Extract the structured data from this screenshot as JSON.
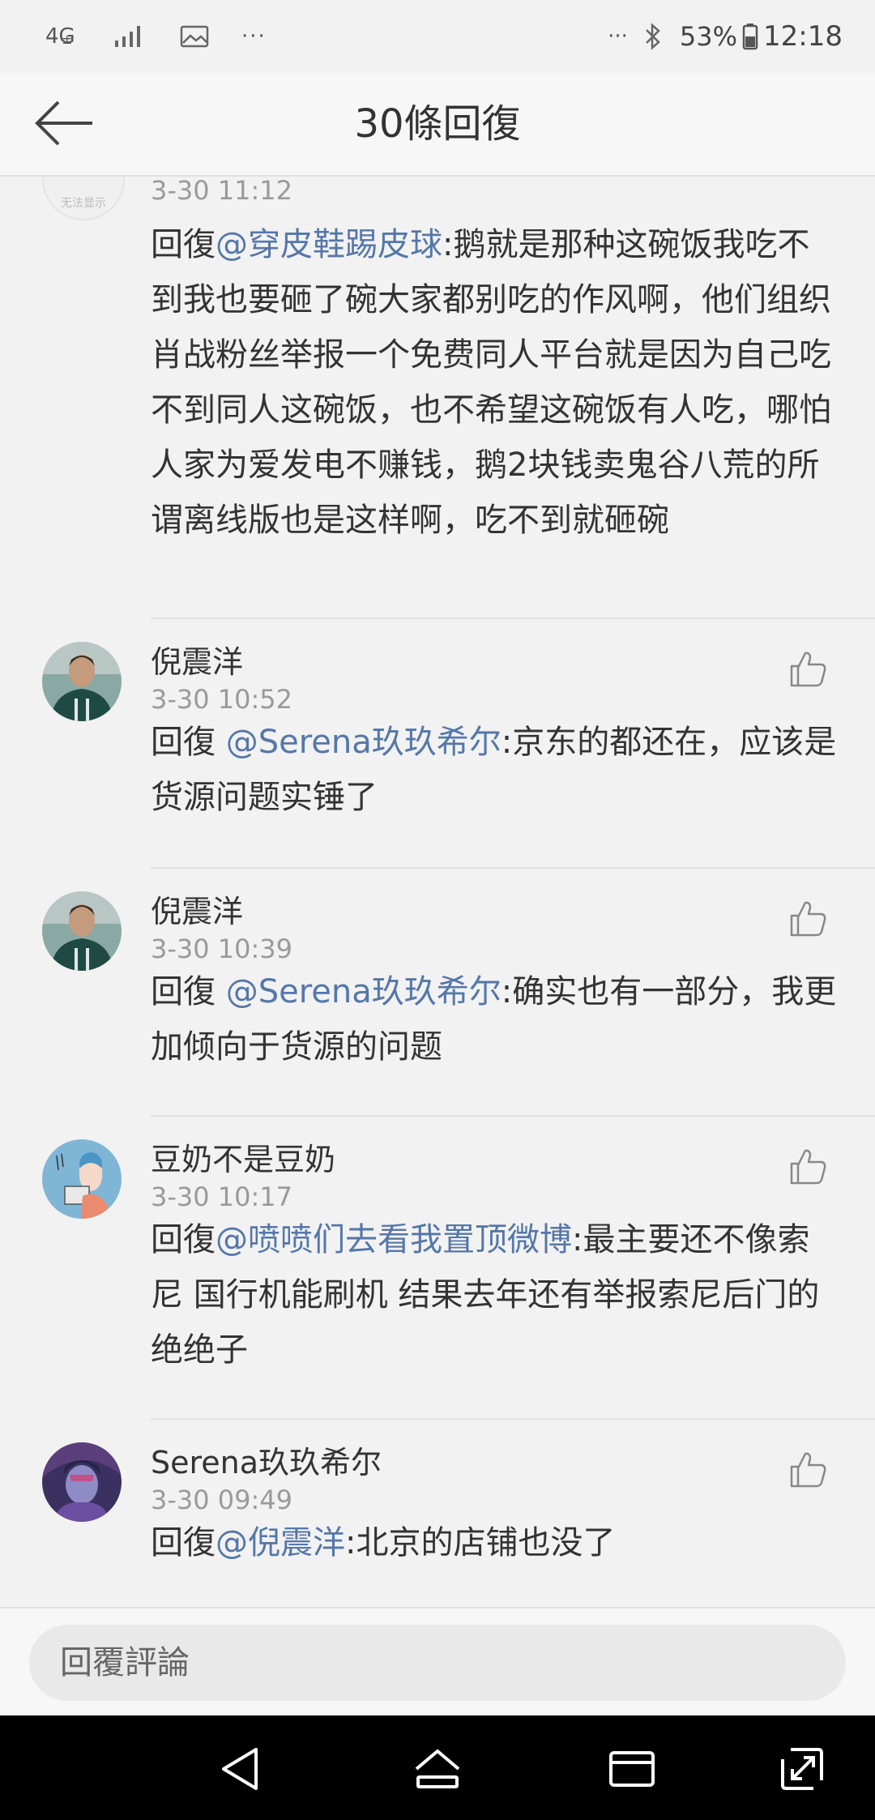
{
  "status_bar": {
    "network": "4G",
    "network_sub": "±",
    "left_more": "···",
    "right_more": "···",
    "battery_percent": "53%",
    "time": "12:18",
    "icons": [
      "signal-icon",
      "image-icon",
      "bluetooth-icon",
      "battery-icon"
    ]
  },
  "header": {
    "title": "30條回復",
    "back_icon": "back-arrow-icon"
  },
  "comments": [
    {
      "user": "",
      "time": "3-30 11:12",
      "reply_prefix": "回復",
      "mention": "@穿皮鞋踢皮球",
      "text": ":鹅就是那种这碗饭我吃不到我也要砸了碗大家都别吃的作风啊，他们组织肖战粉丝举报一个免费同人平台就是因为自己吃不到同人这碗饭，也不希望这碗饭有人吃，哪怕人家为爱发电不赚钱，鹅2块钱卖鬼谷八荒的所谓离线版也是这样啊，吃不到就砸碗",
      "avatar_text": "无法显示"
    },
    {
      "user": "倪震洋",
      "time": "3-30 10:52",
      "reply_prefix": "回復 ",
      "mention": "@Serena玖玖希尔",
      "text": ":京东的都还在，应该是货源问题实锤了"
    },
    {
      "user": "倪震洋",
      "time": "3-30 10:39",
      "reply_prefix": "回復 ",
      "mention": "@Serena玖玖希尔",
      "text": ":确实也有一部分，我更加倾向于货源的问题"
    },
    {
      "user": "豆奶不是豆奶",
      "time": "3-30 10:17",
      "reply_prefix": "回復",
      "mention": "@喷喷们去看我置顶微博",
      "text": ":最主要还不像索尼 国行机能刷机  结果去年还有举报索尼后门的 绝绝子"
    },
    {
      "user": "Serena玖玖希尔",
      "time": "3-30 09:49",
      "reply_prefix": "回復",
      "mention": "@倪震洋",
      "text": ":北京的店铺也没了"
    }
  ],
  "reply_bar": {
    "placeholder": "回覆評論"
  },
  "nav_bar": {
    "icons": [
      "back-triangle-icon",
      "home-icon",
      "recents-icon",
      "expand-icon"
    ]
  }
}
